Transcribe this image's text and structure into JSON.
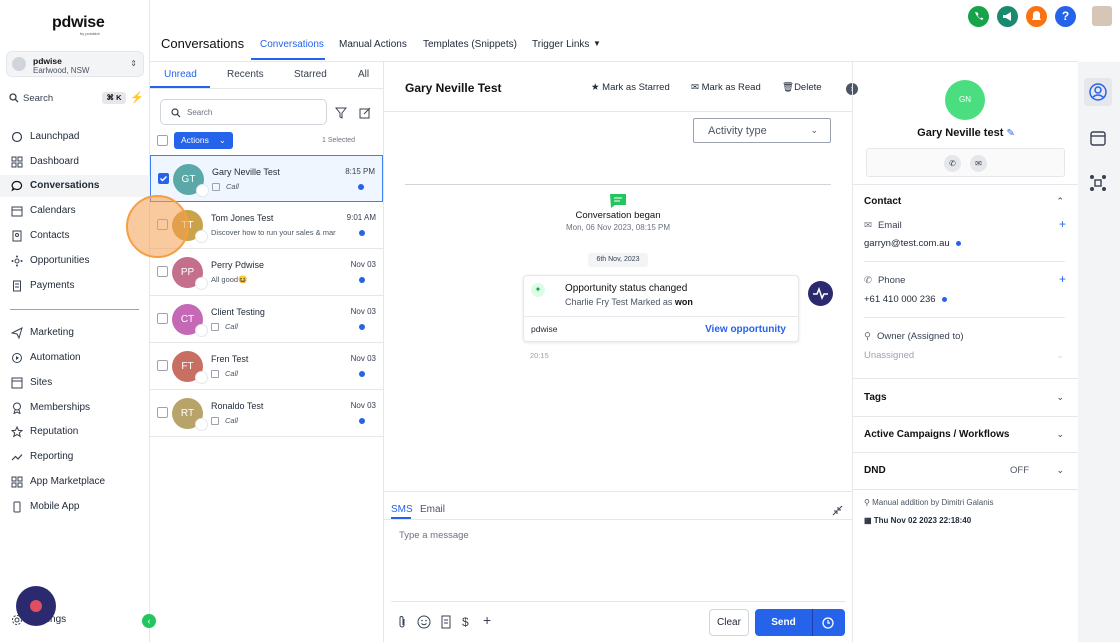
{
  "brand": {
    "name": "pdwise",
    "tagline": "by pointdot"
  },
  "account": {
    "name": "pdwise",
    "location": "Earlwood, NSW"
  },
  "sidebar_search": {
    "label": "Search",
    "shortcut": "⌘ K"
  },
  "nav": [
    {
      "label": "Launchpad",
      "icon": "rocket-icon"
    },
    {
      "label": "Dashboard",
      "icon": "grid-icon"
    },
    {
      "label": "Conversations",
      "icon": "chat-icon"
    },
    {
      "label": "Calendars",
      "icon": "calendar-icon"
    },
    {
      "label": "Contacts",
      "icon": "contact-book-icon"
    },
    {
      "label": "Opportunities",
      "icon": "opportunities-icon"
    },
    {
      "label": "Payments",
      "icon": "receipt-icon"
    },
    {
      "label": "Marketing",
      "icon": "send-icon"
    },
    {
      "label": "Automation",
      "icon": "automation-icon"
    },
    {
      "label": "Sites",
      "icon": "sites-icon"
    },
    {
      "label": "Memberships",
      "icon": "membership-icon"
    },
    {
      "label": "Reputation",
      "icon": "star-icon"
    },
    {
      "label": "Reporting",
      "icon": "trend-icon"
    },
    {
      "label": "App Marketplace",
      "icon": "apps-icon"
    },
    {
      "label": "Mobile App",
      "icon": "phone-icon"
    }
  ],
  "settings_label": "Settings",
  "header": {
    "title": "Conversations",
    "tabs": [
      "Conversations",
      "Manual Actions",
      "Templates (Snippets)",
      "Trigger Links"
    ],
    "top_icon_colors": [
      "#16a34a",
      "#188a6e",
      "#f97316",
      "#2563eb"
    ]
  },
  "list": {
    "tabs": [
      "Unread",
      "Recents",
      "Starred",
      "All"
    ],
    "search_placeholder": "Search",
    "actions_label": "Actions",
    "selected_count": "1 Selected",
    "rows": [
      {
        "initials": "GT",
        "name": "Gary Neville Test",
        "preview": "Call",
        "time": "8:15 PM",
        "color": "#5aa9a8",
        "type": "call"
      },
      {
        "initials": "TT",
        "name": "Tom Jones Test",
        "preview": "Discover how to run your sales & mar",
        "time": "9:01 AM",
        "color": "#c9a24a",
        "type": "message"
      },
      {
        "initials": "PP",
        "name": "Perry Pdwise",
        "preview": "All good😆",
        "time": "Nov 03",
        "color": "#c46f8c",
        "type": "message"
      },
      {
        "initials": "CT",
        "name": "Client Testing",
        "preview": "Call",
        "time": "Nov 03",
        "color": "#c569b7",
        "type": "call"
      },
      {
        "initials": "FT",
        "name": "Fren Test",
        "preview": "Call",
        "time": "Nov 03",
        "color": "#c86f63",
        "type": "call"
      },
      {
        "initials": "RT",
        "name": "Ronaldo Test",
        "preview": "Call",
        "time": "Nov 03",
        "color": "#b8a46a",
        "type": "call"
      }
    ]
  },
  "chat": {
    "contact_name": "Gary Neville Test",
    "header_actions": [
      "Mark as Starred",
      "Mark as Read",
      "Delete"
    ],
    "activity_type": "Activity type",
    "began_title": "Conversation began",
    "began_time": "Mon, 06 Nov 2023, 08:15 PM",
    "date_pill": "6th Nov, 2023",
    "card": {
      "title": "Opportunity status changed",
      "detail_prefix": "Charlie Fry Test Marked as ",
      "detail_status": "won",
      "source": "pdwise",
      "link": "View opportunity"
    },
    "msg_time": "20:15",
    "compose": {
      "tabs": [
        "SMS",
        "Email"
      ],
      "placeholder": "Type a message",
      "clear": "Clear",
      "send": "Send"
    }
  },
  "contact_panel": {
    "initials": "GN",
    "name": "Gary Neville test",
    "contact_section": "Contact",
    "email_label": "Email",
    "email": "garryn@test.com.au",
    "phone_label": "Phone",
    "phone": "+61 410 000 236",
    "owner_label": "Owner (Assigned to)",
    "owner_value": "Unassigned",
    "sections": [
      "Tags",
      "Active Campaigns / Workflows",
      "DND"
    ],
    "dnd_value": "OFF",
    "footer_note": "Manual addition by Dimitri Galanis",
    "footer_date": "Thu Nov 02 2023 22:18:40",
    "avatar_color": "#4ade80"
  }
}
